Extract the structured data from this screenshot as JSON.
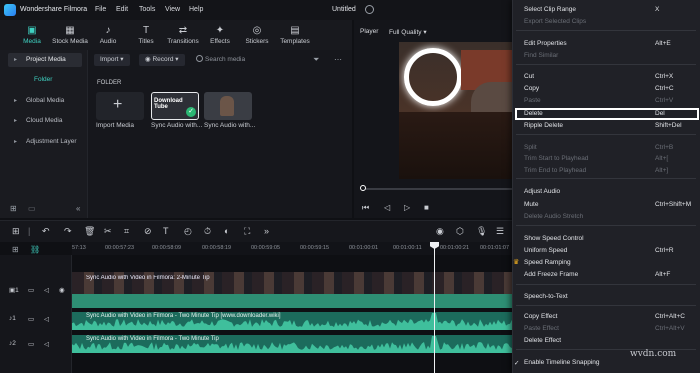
{
  "app": {
    "name": "Wondershare Filmora",
    "project_title": "Untitled"
  },
  "menubar": [
    "File",
    "Edit",
    "Tools",
    "View",
    "Help"
  ],
  "tabs": [
    {
      "label": "Media",
      "icon": "media-icon"
    },
    {
      "label": "Stock Media",
      "icon": "stock-media-icon"
    },
    {
      "label": "Audio",
      "icon": "music-note-icon"
    },
    {
      "label": "Titles",
      "icon": "text-t-icon"
    },
    {
      "label": "Transitions",
      "icon": "transitions-icon"
    },
    {
      "label": "Effects",
      "icon": "effects-icon"
    },
    {
      "label": "Stickers",
      "icon": "stickers-icon"
    },
    {
      "label": "Templates",
      "icon": "templates-icon"
    }
  ],
  "sidebar": {
    "items": [
      "Project Media",
      "Global Media",
      "Cloud Media",
      "Adjustment Layer"
    ],
    "folder_label": "Folder"
  },
  "media_toolbar": {
    "import_label": "Import",
    "record_label": "Record",
    "search_placeholder": "Search media"
  },
  "media": {
    "section_label": "FOLDER",
    "import_card_label": "Import Media",
    "clips": [
      {
        "label": "Sync Audio with...",
        "thumb_text": "Download Tube"
      },
      {
        "label": "Sync Audio with..."
      }
    ]
  },
  "preview": {
    "player_label": "Player",
    "quality_label": "Full Quality"
  },
  "timeline": {
    "ticks": [
      "57:13",
      "00:00:57:23",
      "00:00:58:09",
      "00:00:58:19",
      "00:00:59:05",
      "00:00:59:15",
      "00:01:00:01",
      "00:01:00:11",
      "00:01:00:21",
      "00:01:01:07"
    ],
    "video_clip_label": "Sync Audio with Video in Filmora: 2-Minute Tip",
    "audio_tracks": [
      {
        "label": "Sync Audio with Video in Filmora - Two Minute Tip [www.downloader.wiki]"
      },
      {
        "label": "Sync Audio with Video in Filmora - Two Minute Tip"
      }
    ],
    "track_numbers": [
      "1",
      "1",
      "2"
    ]
  },
  "context_menu": {
    "items": [
      {
        "label": "Select Clip Range",
        "shortcut": "X",
        "enabled": true
      },
      {
        "label": "Export Selected Clips",
        "shortcut": "",
        "enabled": false
      },
      {
        "label": "Edit Properties",
        "shortcut": "Alt+E",
        "enabled": true
      },
      {
        "label": "Find Similar",
        "shortcut": "",
        "enabled": false
      },
      {
        "label": "Cut",
        "shortcut": "Ctrl+X",
        "enabled": true
      },
      {
        "label": "Copy",
        "shortcut": "Ctrl+C",
        "enabled": true
      },
      {
        "label": "Paste",
        "shortcut": "Ctrl+V",
        "enabled": false
      },
      {
        "label": "Delete",
        "shortcut": "Del",
        "enabled": true,
        "highlighted": true
      },
      {
        "label": "Ripple Delete",
        "shortcut": "Shift+Del",
        "enabled": true
      },
      {
        "label": "Split",
        "shortcut": "Ctrl+B",
        "enabled": false
      },
      {
        "label": "Trim Start to Playhead",
        "shortcut": "Alt+[",
        "enabled": false
      },
      {
        "label": "Trim End to Playhead",
        "shortcut": "Alt+]",
        "enabled": false
      },
      {
        "label": "Adjust Audio",
        "shortcut": "",
        "enabled": true
      },
      {
        "label": "Mute",
        "shortcut": "Ctrl+Shift+M",
        "enabled": true
      },
      {
        "label": "Delete Audio Stretch",
        "shortcut": "",
        "enabled": false
      },
      {
        "label": "Show Speed Control",
        "shortcut": "",
        "enabled": true
      },
      {
        "label": "Uniform Speed",
        "shortcut": "Ctrl+R",
        "enabled": true
      },
      {
        "label": "Speed Ramping",
        "shortcut": "",
        "enabled": true
      },
      {
        "label": "Add Freeze Frame",
        "shortcut": "Alt+F",
        "enabled": true
      },
      {
        "label": "Speech-to-Text",
        "shortcut": "",
        "enabled": true
      },
      {
        "label": "Copy Effect",
        "shortcut": "Ctrl+Alt+C",
        "enabled": true
      },
      {
        "label": "Paste Effect",
        "shortcut": "Ctrl+Alt+V",
        "enabled": false
      },
      {
        "label": "Delete Effect",
        "shortcut": "",
        "enabled": true
      },
      {
        "label": "Enable Timeline Snapping",
        "shortcut": "",
        "enabled": true,
        "checked": true
      }
    ]
  },
  "watermark": "wvdn.com",
  "colors": {
    "accent": "#3fd1c1",
    "audio_track": "#1c6b5c",
    "video_audio": "#2e8f74"
  }
}
